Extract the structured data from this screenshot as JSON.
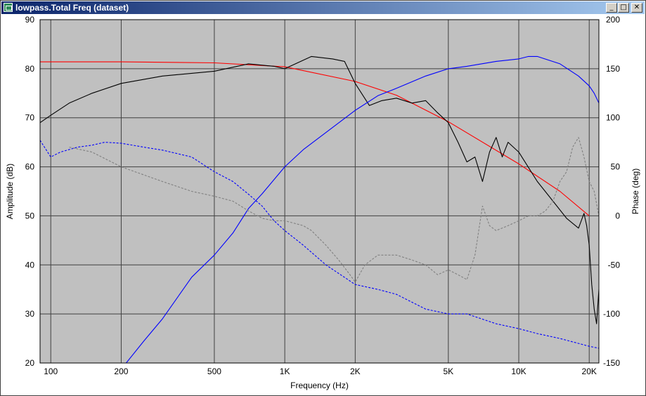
{
  "window": {
    "title": "lowpass.Total Freq (dataset)",
    "minimize_glyph": "_",
    "maximize_glyph": "□",
    "close_glyph": "✕",
    "icon": "chart-app-icon"
  },
  "chart_data": {
    "type": "line",
    "title": "",
    "xlabel": "Frequency (Hz)",
    "ylabel": "Amplitude (dB)",
    "y2label": "Phase (deg)",
    "xscale": "log",
    "xlim": [
      90,
      22000
    ],
    "ylim": [
      20,
      90
    ],
    "y2lim": [
      -150,
      200
    ],
    "grid": true,
    "background": "#c0c0c0",
    "x_ticks": [
      {
        "v": 100,
        "label": "100"
      },
      {
        "v": 200,
        "label": "200"
      },
      {
        "v": 500,
        "label": "500"
      },
      {
        "v": 1000,
        "label": "1K"
      },
      {
        "v": 2000,
        "label": "2K"
      },
      {
        "v": 5000,
        "label": "5K"
      },
      {
        "v": 10000,
        "label": "10K"
      },
      {
        "v": 20000,
        "label": "20K"
      }
    ],
    "y_ticks": [
      {
        "v": 20,
        "label": "20"
      },
      {
        "v": 30,
        "label": "30"
      },
      {
        "v": 40,
        "label": "40"
      },
      {
        "v": 50,
        "label": "50"
      },
      {
        "v": 60,
        "label": "60"
      },
      {
        "v": 70,
        "label": "70"
      },
      {
        "v": 80,
        "label": "80"
      },
      {
        "v": 90,
        "label": "90"
      }
    ],
    "y2_ticks": [
      {
        "v": -150,
        "label": "-150"
      },
      {
        "v": -100,
        "label": "-100"
      },
      {
        "v": -50,
        "label": "-50"
      },
      {
        "v": 0,
        "label": "0"
      },
      {
        "v": 50,
        "label": "50"
      },
      {
        "v": 100,
        "label": "100"
      },
      {
        "v": 150,
        "label": "150"
      },
      {
        "v": 200,
        "label": "200"
      }
    ],
    "series": [
      {
        "axis": "y2",
        "color": "#ff0000",
        "style": "solid",
        "x": [
          90,
          200,
          500,
          1000,
          2000,
          3000,
          5000,
          10000,
          15000,
          20000
        ],
        "y": [
          157,
          157,
          156,
          152,
          137,
          123,
          96,
          53,
          25,
          0
        ]
      },
      {
        "axis": "y",
        "color": "#000000",
        "style": "solid",
        "x": [
          90,
          100,
          120,
          150,
          200,
          300,
          500,
          700,
          900,
          1000,
          1300,
          1600,
          1800,
          2000,
          2300,
          2600,
          3000,
          3500,
          4000,
          4500,
          5000,
          5500,
          6000,
          6500,
          7000,
          7500,
          8000,
          8500,
          9000,
          10000,
          12000,
          14000,
          16000,
          18000,
          19000,
          19500,
          20000,
          20500,
          21000,
          21500,
          22000
        ],
        "y": [
          69,
          70.5,
          73,
          75,
          77,
          78.5,
          79.5,
          81,
          80.5,
          80,
          82.5,
          82,
          81.5,
          77,
          72.5,
          73.5,
          74,
          73,
          73.5,
          71,
          69,
          65,
          61,
          62,
          57,
          63,
          66,
          62,
          65,
          63,
          57,
          53,
          49.5,
          47.5,
          50.5,
          48,
          44,
          36,
          31,
          28,
          35
        ]
      },
      {
        "axis": "y",
        "color": "#0000ff",
        "style": "solid",
        "x": [
          210,
          250,
          300,
          400,
          500,
          600,
          700,
          800,
          1000,
          1200,
          1500,
          2000,
          2500,
          3000,
          4000,
          5000,
          6000,
          8000,
          10000,
          11000,
          12000,
          15000,
          18000,
          20000,
          21000,
          22000
        ],
        "y": [
          20,
          24.5,
          29,
          37.5,
          42,
          46.5,
          51.5,
          54.5,
          60,
          63.5,
          67,
          71.5,
          74.5,
          76,
          78.5,
          80,
          80.5,
          81.5,
          82,
          82.5,
          82.5,
          81,
          78.5,
          76.5,
          75,
          73
        ]
      },
      {
        "axis": "y2",
        "color": "#0000ff",
        "style": "dashed",
        "x": [
          90,
          100,
          110,
          130,
          150,
          170,
          200,
          250,
          300,
          400,
          500,
          600,
          700,
          800,
          900,
          1000,
          1200,
          1500,
          2000,
          2500,
          3000,
          4000,
          5000,
          6000,
          8000,
          10000,
          12000,
          15000,
          18000,
          20000,
          22000
        ],
        "y": [
          77,
          60,
          65,
          70,
          72,
          75,
          74,
          70,
          67,
          60,
          45,
          35,
          22,
          10,
          -5,
          -15,
          -30,
          -50,
          -70,
          -75,
          -80,
          -95,
          -100,
          -100,
          -110,
          -115,
          -120,
          -125,
          -130,
          -133,
          -135
        ]
      },
      {
        "axis": "y",
        "color": "#808080",
        "style": "dashed",
        "x": [
          120,
          150,
          200,
          300,
          400,
          500,
          600,
          700,
          800,
          900,
          1000,
          1200,
          1300,
          1500,
          1700,
          1900,
          2000,
          2200,
          2500,
          3000,
          3500,
          4000,
          4500,
          5000,
          5500,
          6000,
          6500,
          7000,
          7500,
          8000,
          9000,
          10000,
          11000,
          12000,
          13000,
          14000,
          15000,
          16000,
          17000,
          18000,
          19000,
          20000,
          21000,
          22000
        ],
        "y": [
          64,
          63,
          60,
          57,
          55,
          54,
          53,
          51,
          49.5,
          49,
          49,
          48,
          47,
          44,
          41,
          38,
          36.5,
          40,
          42,
          42,
          41,
          40,
          38,
          39,
          38,
          37,
          42,
          52,
          48,
          47,
          48,
          49,
          50,
          50,
          51,
          53,
          57,
          59,
          64,
          66,
          62,
          57,
          55,
          50
        ]
      }
    ]
  }
}
